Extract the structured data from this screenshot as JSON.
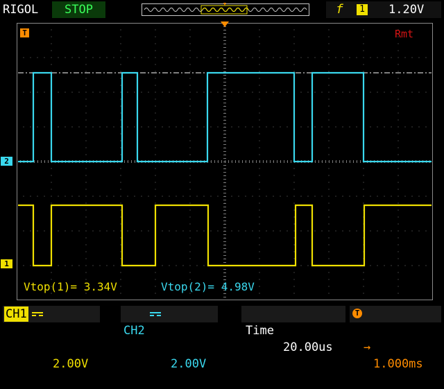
{
  "header": {
    "brand": "RIGOL",
    "run_state": "STOP",
    "trigger_source": "1",
    "trigger_level": "1.20V"
  },
  "screen": {
    "remote_label": "Rmt",
    "ch1_marker": "1",
    "ch2_marker": "2",
    "trigger_marker": "T"
  },
  "measurements": {
    "m1": "Vtop(1)= 3.34V",
    "m2": "Vtop(2)= 4.98V"
  },
  "status": {
    "ch1_label": "CH1",
    "ch1_scale": "2.00V",
    "ch2_label": "CH2",
    "ch2_scale": "2.00V",
    "time_label": "Time",
    "time_scale": "20.00us",
    "trigger_offset": "1.000ms"
  },
  "colors": {
    "ch1": "#f0e000",
    "ch2": "#3ad8ee",
    "grid": "#7a7a7a",
    "trigger": "#ff8c00"
  }
}
